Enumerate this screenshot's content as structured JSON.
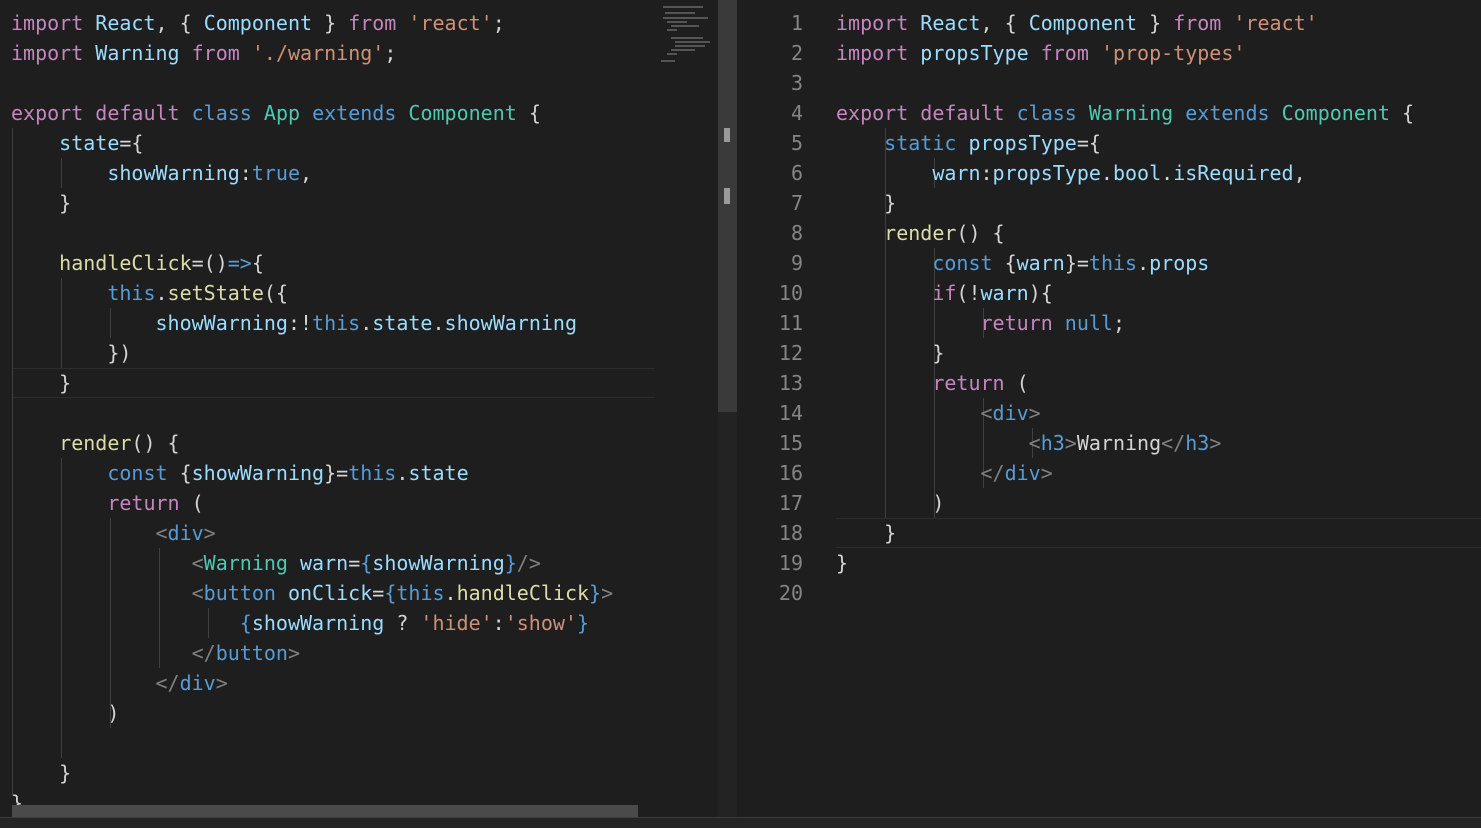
{
  "editor_left": {
    "lines": [
      [
        [
          "kw-purple",
          "import"
        ],
        [
          "txt",
          " "
        ],
        [
          "ident",
          "React"
        ],
        [
          "txt",
          ", { "
        ],
        [
          "ident",
          "Component"
        ],
        [
          "txt",
          " } "
        ],
        [
          "kw-purple",
          "from"
        ],
        [
          "txt",
          " "
        ],
        [
          "str",
          "'react'"
        ],
        [
          "txt",
          ";"
        ]
      ],
      [
        [
          "kw-purple",
          "import"
        ],
        [
          "txt",
          " "
        ],
        [
          "ident",
          "Warning"
        ],
        [
          "txt",
          " "
        ],
        [
          "kw-purple",
          "from"
        ],
        [
          "txt",
          " "
        ],
        [
          "str",
          "'./warning'"
        ],
        [
          "txt",
          ";"
        ]
      ],
      [],
      [
        [
          "kw-purple",
          "export"
        ],
        [
          "txt",
          " "
        ],
        [
          "kw-purple",
          "default"
        ],
        [
          "txt",
          " "
        ],
        [
          "kw-blue",
          "class"
        ],
        [
          "txt",
          " "
        ],
        [
          "cls",
          "App"
        ],
        [
          "txt",
          " "
        ],
        [
          "kw-blue",
          "extends"
        ],
        [
          "txt",
          " "
        ],
        [
          "cls",
          "Component"
        ],
        [
          "txt",
          " {"
        ]
      ],
      [
        [
          "txt",
          "    "
        ],
        [
          "ident",
          "state"
        ],
        [
          "txt",
          "={"
        ]
      ],
      [
        [
          "txt",
          "        "
        ],
        [
          "ident",
          "showWarning"
        ],
        [
          "txt",
          ":"
        ],
        [
          "kw-blue",
          "true"
        ],
        [
          "txt",
          ","
        ]
      ],
      [
        [
          "txt",
          "    }"
        ]
      ],
      [],
      [
        [
          "txt",
          "    "
        ],
        [
          "fn",
          "handleClick"
        ],
        [
          "txt",
          "=()"
        ],
        [
          "kw-blue",
          "=>"
        ],
        [
          "txt",
          "{"
        ]
      ],
      [
        [
          "txt",
          "        "
        ],
        [
          "kw-blue",
          "this"
        ],
        [
          "txt",
          "."
        ],
        [
          "fn",
          "setState"
        ],
        [
          "txt",
          "({"
        ]
      ],
      [
        [
          "txt",
          "            "
        ],
        [
          "ident",
          "showWarning"
        ],
        [
          "txt",
          ":!"
        ],
        [
          "kw-blue",
          "this"
        ],
        [
          "txt",
          "."
        ],
        [
          "ident",
          "state"
        ],
        [
          "txt",
          "."
        ],
        [
          "ident",
          "showWarning"
        ]
      ],
      [
        [
          "txt",
          "        })"
        ]
      ],
      [
        [
          "txt",
          "    }"
        ]
      ],
      [],
      [
        [
          "txt",
          "    "
        ],
        [
          "fn",
          "render"
        ],
        [
          "txt",
          "() {"
        ]
      ],
      [
        [
          "txt",
          "        "
        ],
        [
          "kw-blue",
          "const"
        ],
        [
          "txt",
          " {"
        ],
        [
          "ident",
          "showWarning"
        ],
        [
          "txt",
          "}="
        ],
        [
          "kw-blue",
          "this"
        ],
        [
          "txt",
          "."
        ],
        [
          "ident",
          "state"
        ]
      ],
      [
        [
          "txt",
          "        "
        ],
        [
          "kw-purple",
          "return"
        ],
        [
          "txt",
          " ("
        ]
      ],
      [
        [
          "txt",
          "            "
        ],
        [
          "tagbr",
          "<"
        ],
        [
          "tag",
          "div"
        ],
        [
          "tagbr",
          ">"
        ]
      ],
      [
        [
          "txt",
          "               "
        ],
        [
          "tagbr",
          "<"
        ],
        [
          "cls",
          "Warning"
        ],
        [
          "txt",
          " "
        ],
        [
          "ident",
          "warn"
        ],
        [
          "txt",
          "="
        ],
        [
          "jsx-br",
          "{"
        ],
        [
          "ident",
          "showWarning"
        ],
        [
          "jsx-br",
          "}"
        ],
        [
          "tagbr",
          "/>"
        ]
      ],
      [
        [
          "txt",
          "               "
        ],
        [
          "tagbr",
          "<"
        ],
        [
          "tag",
          "button"
        ],
        [
          "txt",
          " "
        ],
        [
          "ident",
          "onClick"
        ],
        [
          "txt",
          "="
        ],
        [
          "jsx-br",
          "{"
        ],
        [
          "kw-blue",
          "this"
        ],
        [
          "txt",
          "."
        ],
        [
          "fn",
          "handleClick"
        ],
        [
          "jsx-br",
          "}"
        ],
        [
          "tagbr",
          ">"
        ]
      ],
      [
        [
          "txt",
          "                   "
        ],
        [
          "jsx-br",
          "{"
        ],
        [
          "ident",
          "showWarning"
        ],
        [
          "txt",
          " ? "
        ],
        [
          "str",
          "'hide'"
        ],
        [
          "txt",
          ":"
        ],
        [
          "str",
          "'show'"
        ],
        [
          "jsx-br",
          "}"
        ]
      ],
      [
        [
          "txt",
          "               "
        ],
        [
          "tagbr",
          "</"
        ],
        [
          "tag",
          "button"
        ],
        [
          "tagbr",
          ">"
        ]
      ],
      [
        [
          "txt",
          "            "
        ],
        [
          "tagbr",
          "</"
        ],
        [
          "tag",
          "div"
        ],
        [
          "tagbr",
          ">"
        ]
      ],
      [
        [
          "txt",
          "        )"
        ]
      ],
      [],
      [
        [
          "txt",
          "    }"
        ]
      ],
      [
        [
          "txt",
          "}"
        ]
      ]
    ]
  },
  "editor_right": {
    "line_numbers": [
      "1",
      "2",
      "3",
      "4",
      "5",
      "6",
      "7",
      "8",
      "9",
      "10",
      "11",
      "12",
      "13",
      "14",
      "15",
      "16",
      "17",
      "18",
      "19",
      "20"
    ],
    "lines": [
      [
        [
          "kw-purple",
          "import"
        ],
        [
          "txt",
          " "
        ],
        [
          "ident",
          "React"
        ],
        [
          "txt",
          ", { "
        ],
        [
          "ident",
          "Component"
        ],
        [
          "txt",
          " } "
        ],
        [
          "kw-purple",
          "from"
        ],
        [
          "txt",
          " "
        ],
        [
          "str",
          "'react'"
        ]
      ],
      [
        [
          "kw-purple",
          "import"
        ],
        [
          "txt",
          " "
        ],
        [
          "ident",
          "propsType"
        ],
        [
          "txt",
          " "
        ],
        [
          "kw-purple",
          "from"
        ],
        [
          "txt",
          " "
        ],
        [
          "str",
          "'prop-types'"
        ]
      ],
      [],
      [
        [
          "kw-purple",
          "export"
        ],
        [
          "txt",
          " "
        ],
        [
          "kw-purple",
          "default"
        ],
        [
          "txt",
          " "
        ],
        [
          "kw-blue",
          "class"
        ],
        [
          "txt",
          " "
        ],
        [
          "cls",
          "Warning"
        ],
        [
          "txt",
          " "
        ],
        [
          "kw-blue",
          "extends"
        ],
        [
          "txt",
          " "
        ],
        [
          "cls",
          "Component"
        ],
        [
          "txt",
          " {"
        ]
      ],
      [
        [
          "txt",
          "    "
        ],
        [
          "kw-blue",
          "static"
        ],
        [
          "txt",
          " "
        ],
        [
          "ident",
          "propsType"
        ],
        [
          "txt",
          "={"
        ]
      ],
      [
        [
          "txt",
          "        "
        ],
        [
          "ident",
          "warn"
        ],
        [
          "txt",
          ":"
        ],
        [
          "ident",
          "propsType"
        ],
        [
          "txt",
          "."
        ],
        [
          "ident",
          "bool"
        ],
        [
          "txt",
          "."
        ],
        [
          "ident",
          "isRequired"
        ],
        [
          "txt",
          ","
        ]
      ],
      [
        [
          "txt",
          "    }"
        ]
      ],
      [
        [
          "txt",
          "    "
        ],
        [
          "fn",
          "render"
        ],
        [
          "txt",
          "() {"
        ]
      ],
      [
        [
          "txt",
          "        "
        ],
        [
          "kw-blue",
          "const"
        ],
        [
          "txt",
          " {"
        ],
        [
          "ident",
          "warn"
        ],
        [
          "txt",
          "}="
        ],
        [
          "kw-blue",
          "this"
        ],
        [
          "txt",
          "."
        ],
        [
          "ident",
          "props"
        ]
      ],
      [
        [
          "txt",
          "        "
        ],
        [
          "kw-purple",
          "if"
        ],
        [
          "txt",
          "(!"
        ],
        [
          "ident",
          "warn"
        ],
        [
          "txt",
          "){"
        ]
      ],
      [
        [
          "txt",
          "            "
        ],
        [
          "kw-purple",
          "return"
        ],
        [
          "txt",
          " "
        ],
        [
          "kw-blue",
          "null"
        ],
        [
          "txt",
          ";"
        ]
      ],
      [
        [
          "txt",
          "        }"
        ]
      ],
      [
        [
          "txt",
          "        "
        ],
        [
          "kw-purple",
          "return"
        ],
        [
          "txt",
          " ("
        ]
      ],
      [
        [
          "txt",
          "            "
        ],
        [
          "tagbr",
          "<"
        ],
        [
          "tag",
          "div"
        ],
        [
          "tagbr",
          ">"
        ]
      ],
      [
        [
          "txt",
          "                "
        ],
        [
          "tagbr",
          "<"
        ],
        [
          "tag",
          "h3"
        ],
        [
          "tagbr",
          ">"
        ],
        [
          "txt",
          "Warning"
        ],
        [
          "tagbr",
          "</"
        ],
        [
          "tag",
          "h3"
        ],
        [
          "tagbr",
          ">"
        ]
      ],
      [
        [
          "txt",
          "            "
        ],
        [
          "tagbr",
          "</"
        ],
        [
          "tag",
          "div"
        ],
        [
          "tagbr",
          ">"
        ]
      ],
      [
        [
          "txt",
          "        )"
        ]
      ],
      [
        [
          "txt",
          "    }"
        ]
      ],
      [
        [
          "txt",
          "}"
        ]
      ],
      []
    ]
  }
}
